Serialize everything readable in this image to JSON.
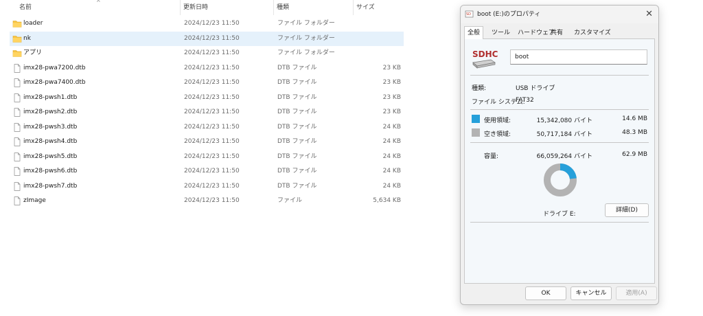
{
  "columns": {
    "name": "名前",
    "date": "更新日時",
    "type": "種類",
    "size": "サイズ"
  },
  "files": [
    {
      "name": "loader",
      "date": "2024/12/23 11:50",
      "type": "ファイル フォルダー",
      "size": "",
      "icon": "folder-icon"
    },
    {
      "name": "nk",
      "date": "2024/12/23 11:50",
      "type": "ファイル フォルダー",
      "size": "",
      "icon": "folder-icon",
      "selected": true
    },
    {
      "name": "アプリ",
      "date": "2024/12/23 11:50",
      "type": "ファイル フォルダー",
      "size": "",
      "icon": "folder-icon"
    },
    {
      "name": "imx28-pwa7200.dtb",
      "date": "2024/12/23 11:50",
      "type": "DTB ファイル",
      "size": "23 KB",
      "icon": "file-icon"
    },
    {
      "name": "imx28-pwa7400.dtb",
      "date": "2024/12/23 11:50",
      "type": "DTB ファイル",
      "size": "23 KB",
      "icon": "file-icon"
    },
    {
      "name": "imx28-pwsh1.dtb",
      "date": "2024/12/23 11:50",
      "type": "DTB ファイル",
      "size": "23 KB",
      "icon": "file-icon"
    },
    {
      "name": "imx28-pwsh2.dtb",
      "date": "2024/12/23 11:50",
      "type": "DTB ファイル",
      "size": "23 KB",
      "icon": "file-icon"
    },
    {
      "name": "imx28-pwsh3.dtb",
      "date": "2024/12/23 11:50",
      "type": "DTB ファイル",
      "size": "24 KB",
      "icon": "file-icon"
    },
    {
      "name": "imx28-pwsh4.dtb",
      "date": "2024/12/23 11:50",
      "type": "DTB ファイル",
      "size": "24 KB",
      "icon": "file-icon"
    },
    {
      "name": "imx28-pwsh5.dtb",
      "date": "2024/12/23 11:50",
      "type": "DTB ファイル",
      "size": "24 KB",
      "icon": "file-icon"
    },
    {
      "name": "imx28-pwsh6.dtb",
      "date": "2024/12/23 11:50",
      "type": "DTB ファイル",
      "size": "24 KB",
      "icon": "file-icon"
    },
    {
      "name": "imx28-pwsh7.dtb",
      "date": "2024/12/23 11:50",
      "type": "DTB ファイル",
      "size": "24 KB",
      "icon": "file-icon"
    },
    {
      "name": "zImage",
      "date": "2024/12/23 11:50",
      "type": "ファイル",
      "size": "5,634 KB",
      "icon": "file-icon"
    }
  ],
  "dialog": {
    "title": "boot (E:)のプロパティ",
    "close_label": "✕",
    "tabs": [
      "全般",
      "ツール",
      "ハードウェア",
      "共有",
      "カスタマイズ"
    ],
    "active_tab": 0,
    "volume_label": "boot",
    "icon_text": "SDHC",
    "type_label": "種類:",
    "type_value": "USB ドライブ",
    "fs_label": "ファイル システム:",
    "fs_value": "FAT32",
    "used_label": "使用領域:",
    "used_bytes": "15,342,080 バイト",
    "used_size": "14.6 MB",
    "free_label": "空き領域:",
    "free_bytes": "50,717,184 バイト",
    "free_size": "48.3 MB",
    "capacity_label": "容量:",
    "capacity_bytes": "66,059,264 バイト",
    "capacity_size": "62.9 MB",
    "used_fraction": 0.232,
    "drive_label": "ドライブ E:",
    "details_button": "詳細(D)",
    "ok_button": "OK",
    "cancel_button": "キャンセル",
    "apply_button": "適用(A)"
  },
  "colors": {
    "used": "#26a0da",
    "free": "#b3b3b3",
    "selection": "#e5f1fb",
    "folder": "#f8c443"
  }
}
